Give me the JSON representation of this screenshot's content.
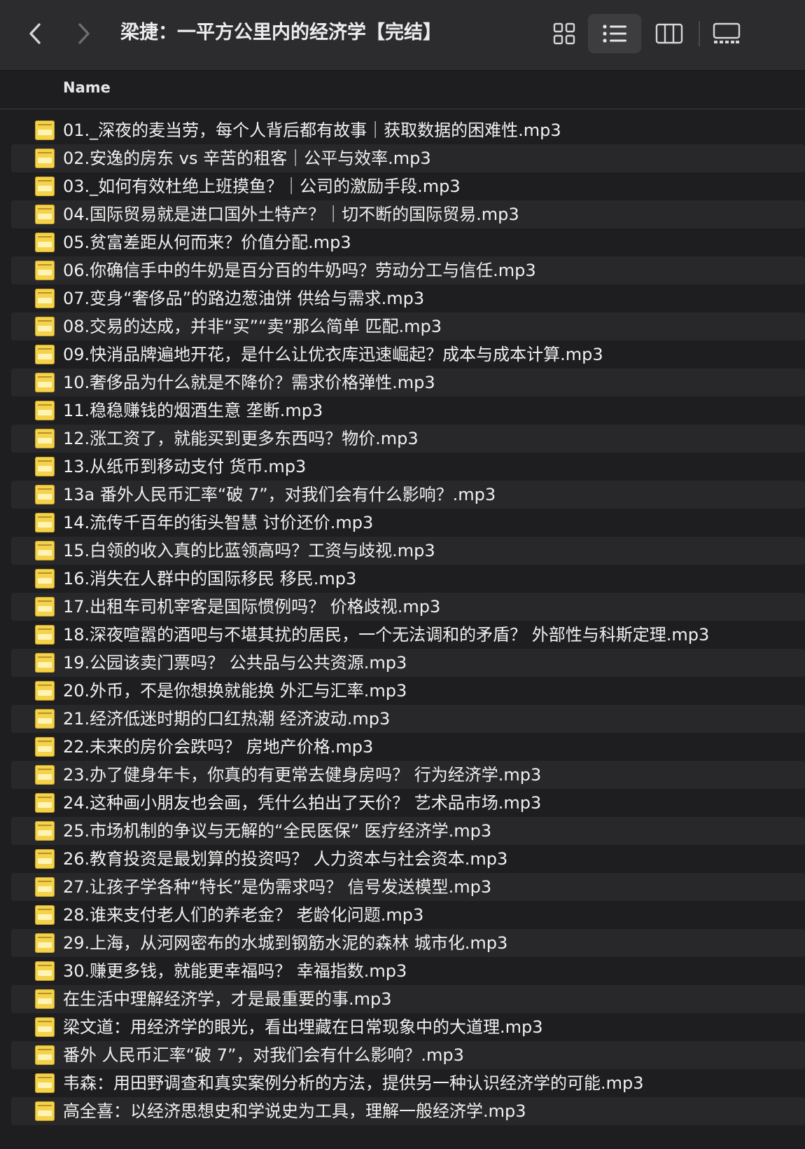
{
  "window": {
    "title": "梁捷：一平方公里内的经济学【完结】",
    "back_icon": "chevron-left-icon",
    "forward_icon": "chevron-right-icon",
    "views": [
      "icon-view-icon",
      "list-view-icon",
      "column-view-icon",
      "gallery-view-icon"
    ],
    "active_view": "list"
  },
  "header": {
    "name_label": "Name"
  },
  "files": [
    "01._深夜的麦当劳，每个人背后都有故事｜获取数据的困难性.mp3",
    "02.安逸的房东 vs 辛苦的租客｜公平与效率.mp3",
    "03._如何有效杜绝上班摸鱼？｜公司的激励手段.mp3",
    "04.国际贸易就是进口国外土特产？｜切不断的国际贸易.mp3",
    "05.贫富差距从何而来？价值分配.mp3",
    "06.你确信手中的牛奶是百分百的牛奶吗？劳动分工与信任.mp3",
    "07.变身“奢侈品”的路边葱油饼 供给与需求.mp3",
    "08.交易的达成，并非“买”“卖”那么简单 匹配.mp3",
    "09.快消品牌遍地开花，是什么让优衣库迅速崛起？成本与成本计算.mp3",
    "10.奢侈品为什么就是不降价？需求价格弹性.mp3",
    "11.稳稳赚钱的烟酒生意 垄断.mp3",
    "12.涨工资了，就能买到更多东西吗？物价.mp3",
    "13.从纸币到移动支付 货币.mp3",
    "13a 番外人民币汇率“破 7”，对我们会有什么影响？.mp3",
    "14.流传千百年的街头智慧 讨价还价.mp3",
    "15.白领的收入真的比蓝领高吗？工资与歧视.mp3",
    "16.消失在人群中的国际移民 移民.mp3",
    "17.出租车司机宰客是国际惯例吗？ 价格歧视.mp3",
    "18.深夜喧嚣的酒吧与不堪其扰的居民，一个无法调和的矛盾？ 外部性与科斯定理.mp3",
    "19.公园该卖门票吗？ 公共品与公共资源.mp3",
    "20.外币，不是你想换就能换 外汇与汇率.mp3",
    "21.经济低迷时期的口红热潮 经济波动.mp3",
    "22.未来的房价会跌吗？ 房地产价格.mp3",
    "23.办了健身年卡，你真的有更常去健身房吗？ 行为经济学.mp3",
    "24.这种画小朋友也会画，凭什么拍出了天价？ 艺术品市场.mp3",
    "25.市场机制的争议与无解的“全民医保” 医疗经济学.mp3",
    "26.教育投资是最划算的投资吗？ 人力资本与社会资本.mp3",
    "27.让孩子学各种“特长”是伪需求吗？ 信号发送模型.mp3",
    "28.谁来支付老人们的养老金？ 老龄化问题.mp3",
    "29.上海，从河网密布的水城到钢筋水泥的森林 城市化.mp3",
    "30.赚更多钱，就能更幸福吗？ 幸福指数.mp3",
    "在生活中理解经济学，才是最重要的事.mp3",
    "梁文道：用经济学的眼光，看出埋藏在日常现象中的大道理.mp3",
    "番外 人民币汇率“破 7”，对我们会有什么影响？.mp3",
    "韦森：用田野调查和真实案例分析的方法，提供另一种认识经济学的可能.mp3",
    "高全喜：以经济思想史和学说史为工具，理解一般经济学.mp3"
  ],
  "file_icon": "audio-file-icon",
  "colors": {
    "background": "#1e1e20",
    "toolbar": "#2c2c2e",
    "row_alt": "#28282a",
    "icon_yellow": "#f4d24a"
  }
}
